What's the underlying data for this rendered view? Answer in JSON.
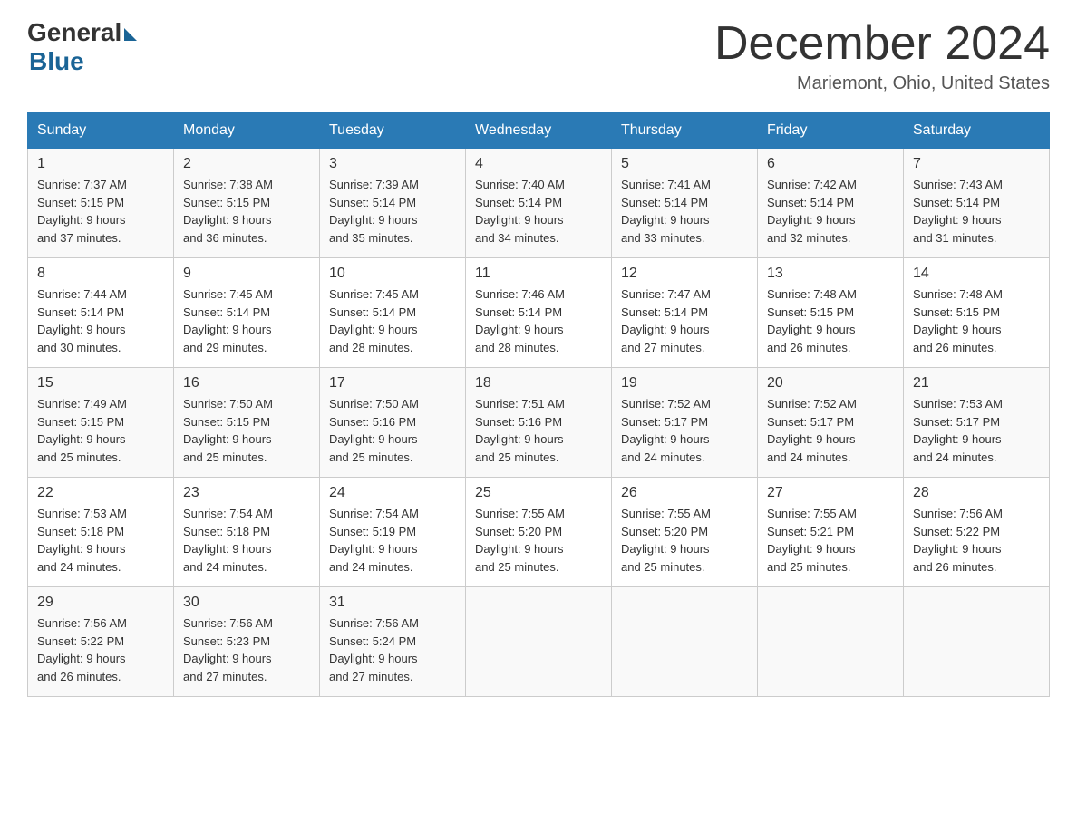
{
  "header": {
    "logo_general": "General",
    "logo_blue": "Blue",
    "month_title": "December 2024",
    "location": "Mariemont, Ohio, United States"
  },
  "days_of_week": [
    "Sunday",
    "Monday",
    "Tuesday",
    "Wednesday",
    "Thursday",
    "Friday",
    "Saturday"
  ],
  "weeks": [
    [
      {
        "num": "1",
        "sunrise": "7:37 AM",
        "sunset": "5:15 PM",
        "daylight": "9 hours and 37 minutes."
      },
      {
        "num": "2",
        "sunrise": "7:38 AM",
        "sunset": "5:15 PM",
        "daylight": "9 hours and 36 minutes."
      },
      {
        "num": "3",
        "sunrise": "7:39 AM",
        "sunset": "5:14 PM",
        "daylight": "9 hours and 35 minutes."
      },
      {
        "num": "4",
        "sunrise": "7:40 AM",
        "sunset": "5:14 PM",
        "daylight": "9 hours and 34 minutes."
      },
      {
        "num": "5",
        "sunrise": "7:41 AM",
        "sunset": "5:14 PM",
        "daylight": "9 hours and 33 minutes."
      },
      {
        "num": "6",
        "sunrise": "7:42 AM",
        "sunset": "5:14 PM",
        "daylight": "9 hours and 32 minutes."
      },
      {
        "num": "7",
        "sunrise": "7:43 AM",
        "sunset": "5:14 PM",
        "daylight": "9 hours and 31 minutes."
      }
    ],
    [
      {
        "num": "8",
        "sunrise": "7:44 AM",
        "sunset": "5:14 PM",
        "daylight": "9 hours and 30 minutes."
      },
      {
        "num": "9",
        "sunrise": "7:45 AM",
        "sunset": "5:14 PM",
        "daylight": "9 hours and 29 minutes."
      },
      {
        "num": "10",
        "sunrise": "7:45 AM",
        "sunset": "5:14 PM",
        "daylight": "9 hours and 28 minutes."
      },
      {
        "num": "11",
        "sunrise": "7:46 AM",
        "sunset": "5:14 PM",
        "daylight": "9 hours and 28 minutes."
      },
      {
        "num": "12",
        "sunrise": "7:47 AM",
        "sunset": "5:14 PM",
        "daylight": "9 hours and 27 minutes."
      },
      {
        "num": "13",
        "sunrise": "7:48 AM",
        "sunset": "5:15 PM",
        "daylight": "9 hours and 26 minutes."
      },
      {
        "num": "14",
        "sunrise": "7:48 AM",
        "sunset": "5:15 PM",
        "daylight": "9 hours and 26 minutes."
      }
    ],
    [
      {
        "num": "15",
        "sunrise": "7:49 AM",
        "sunset": "5:15 PM",
        "daylight": "9 hours and 25 minutes."
      },
      {
        "num": "16",
        "sunrise": "7:50 AM",
        "sunset": "5:15 PM",
        "daylight": "9 hours and 25 minutes."
      },
      {
        "num": "17",
        "sunrise": "7:50 AM",
        "sunset": "5:16 PM",
        "daylight": "9 hours and 25 minutes."
      },
      {
        "num": "18",
        "sunrise": "7:51 AM",
        "sunset": "5:16 PM",
        "daylight": "9 hours and 25 minutes."
      },
      {
        "num": "19",
        "sunrise": "7:52 AM",
        "sunset": "5:17 PM",
        "daylight": "9 hours and 24 minutes."
      },
      {
        "num": "20",
        "sunrise": "7:52 AM",
        "sunset": "5:17 PM",
        "daylight": "9 hours and 24 minutes."
      },
      {
        "num": "21",
        "sunrise": "7:53 AM",
        "sunset": "5:17 PM",
        "daylight": "9 hours and 24 minutes."
      }
    ],
    [
      {
        "num": "22",
        "sunrise": "7:53 AM",
        "sunset": "5:18 PM",
        "daylight": "9 hours and 24 minutes."
      },
      {
        "num": "23",
        "sunrise": "7:54 AM",
        "sunset": "5:18 PM",
        "daylight": "9 hours and 24 minutes."
      },
      {
        "num": "24",
        "sunrise": "7:54 AM",
        "sunset": "5:19 PM",
        "daylight": "9 hours and 24 minutes."
      },
      {
        "num": "25",
        "sunrise": "7:55 AM",
        "sunset": "5:20 PM",
        "daylight": "9 hours and 25 minutes."
      },
      {
        "num": "26",
        "sunrise": "7:55 AM",
        "sunset": "5:20 PM",
        "daylight": "9 hours and 25 minutes."
      },
      {
        "num": "27",
        "sunrise": "7:55 AM",
        "sunset": "5:21 PM",
        "daylight": "9 hours and 25 minutes."
      },
      {
        "num": "28",
        "sunrise": "7:56 AM",
        "sunset": "5:22 PM",
        "daylight": "9 hours and 26 minutes."
      }
    ],
    [
      {
        "num": "29",
        "sunrise": "7:56 AM",
        "sunset": "5:22 PM",
        "daylight": "9 hours and 26 minutes."
      },
      {
        "num": "30",
        "sunrise": "7:56 AM",
        "sunset": "5:23 PM",
        "daylight": "9 hours and 27 minutes."
      },
      {
        "num": "31",
        "sunrise": "7:56 AM",
        "sunset": "5:24 PM",
        "daylight": "9 hours and 27 minutes."
      },
      null,
      null,
      null,
      null
    ]
  ]
}
